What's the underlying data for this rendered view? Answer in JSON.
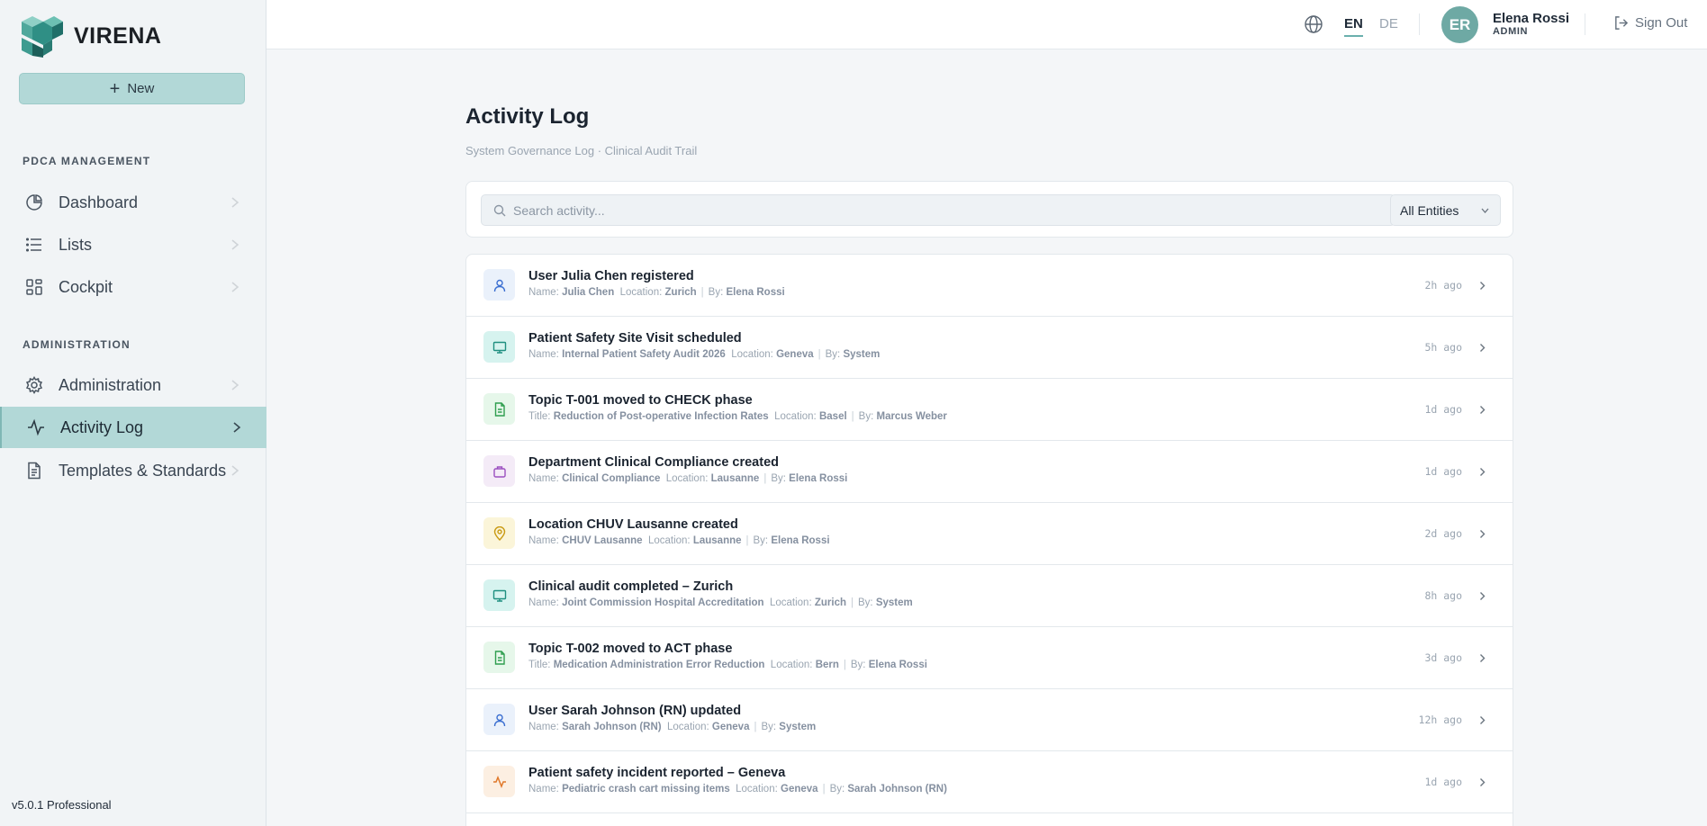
{
  "app": {
    "name": "VIRENA",
    "version": "v5.0.1 Professional"
  },
  "sidebar": {
    "new_label": "New",
    "sections": [
      {
        "title": "PDCA MANAGEMENT",
        "items": [
          {
            "label": "Dashboard",
            "icon": "pie-chart-icon"
          },
          {
            "label": "Lists",
            "icon": "list-icon"
          },
          {
            "label": "Cockpit",
            "icon": "grid-icon"
          }
        ]
      },
      {
        "title": "ADMINISTRATION",
        "items": [
          {
            "label": "Administration",
            "icon": "gear-icon"
          },
          {
            "label": "Activity Log",
            "icon": "activity-icon",
            "active": true
          },
          {
            "label": "Templates & Standards",
            "icon": "document-icon"
          }
        ]
      }
    ]
  },
  "topbar": {
    "languages": [
      "EN",
      "DE"
    ],
    "active_language": "EN",
    "user": {
      "initials": "ER",
      "name": "Elena Rossi",
      "role": "ADMIN"
    },
    "signout_label": "Sign Out"
  },
  "page": {
    "title": "Activity Log",
    "subtitle": "System Governance Log · Clinical Audit Trail",
    "search_placeholder": "Search activity...",
    "entity_filter": "All Entities"
  },
  "activities": [
    {
      "type": "user",
      "title": "User Julia Chen registered",
      "field": "Name:",
      "field_value": "Julia Chen",
      "location_label": "Location:",
      "location": "Zurich",
      "by_label": "By:",
      "by": "Elena Rossi",
      "time": "2h ago"
    },
    {
      "type": "visit",
      "title": "Patient Safety Site Visit scheduled",
      "field": "Name:",
      "field_value": "Internal Patient Safety Audit 2026",
      "location_label": "Location:",
      "location": "Geneva",
      "by_label": "By:",
      "by": "System",
      "time": "5h ago"
    },
    {
      "type": "topic",
      "title": "Topic T-001 moved to CHECK phase",
      "field": "Title:",
      "field_value": "Reduction of Post-operative Infection Rates",
      "location_label": "Location:",
      "location": "Basel",
      "by_label": "By:",
      "by": "Marcus Weber",
      "time": "1d ago"
    },
    {
      "type": "dept",
      "title": "Department Clinical Compliance created",
      "field": "Name:",
      "field_value": "Clinical Compliance",
      "location_label": "Location:",
      "location": "Lausanne",
      "by_label": "By:",
      "by": "Elena Rossi",
      "time": "1d ago"
    },
    {
      "type": "loc",
      "title": "Location CHUV Lausanne created",
      "field": "Name:",
      "field_value": "CHUV Lausanne",
      "location_label": "Location:",
      "location": "Lausanne",
      "by_label": "By:",
      "by": "Elena Rossi",
      "time": "2d ago"
    },
    {
      "type": "visit",
      "title": "Clinical audit completed – Zurich",
      "field": "Name:",
      "field_value": "Joint Commission Hospital Accreditation",
      "location_label": "Location:",
      "location": "Zurich",
      "by_label": "By:",
      "by": "System",
      "time": "8h ago"
    },
    {
      "type": "topic",
      "title": "Topic T-002 moved to ACT phase",
      "field": "Title:",
      "field_value": "Medication Administration Error Reduction",
      "location_label": "Location:",
      "location": "Bern",
      "by_label": "By:",
      "by": "Elena Rossi",
      "time": "3d ago"
    },
    {
      "type": "user",
      "title": "User Sarah Johnson (RN) updated",
      "field": "Name:",
      "field_value": "Sarah Johnson (RN)",
      "location_label": "Location:",
      "location": "Geneva",
      "by_label": "By:",
      "by": "System",
      "time": "12h ago"
    },
    {
      "type": "incident",
      "title": "Patient safety incident reported – Geneva",
      "field": "Name:",
      "field_value": "Pediatric crash cart missing items",
      "location_label": "Location:",
      "location": "Geneva",
      "by_label": "By:",
      "by": "Sarah Johnson (RN)",
      "time": "1d ago"
    }
  ],
  "colors": {
    "accent": "#b2d8d7",
    "avatar": "#6ea9a4",
    "user_icon": "#3b6fd1",
    "visit_icon": "#1f8f80",
    "topic_icon": "#2f9e4f",
    "dept_icon": "#9b4fc0",
    "loc_icon": "#c99a12",
    "incident_icon": "#e0782a"
  }
}
